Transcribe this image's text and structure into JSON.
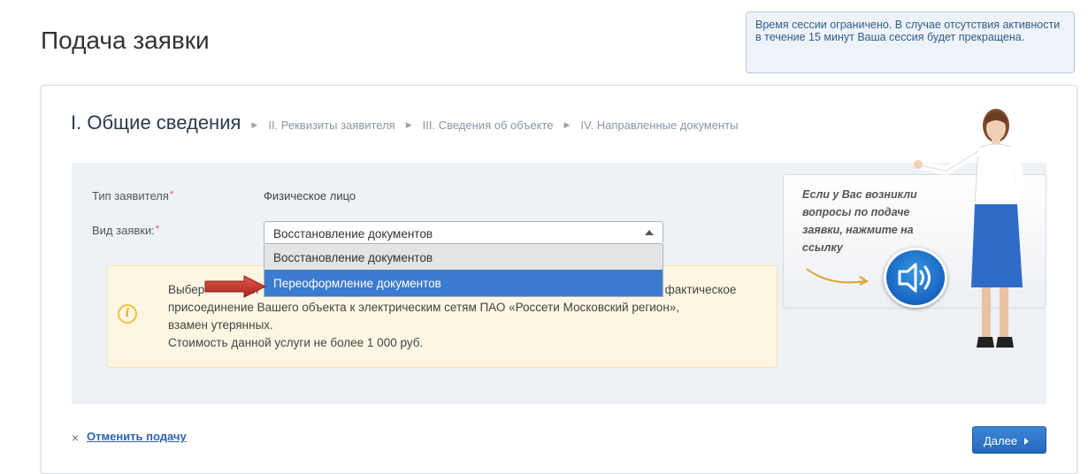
{
  "page": {
    "title": "Подача заявки"
  },
  "session": {
    "notice": "Время сессии ограничено. В случае отсутствия активности в течение 15 минут Ваша сессия будет прекращена."
  },
  "steps": [
    {
      "label": "I. Общие сведения",
      "active": true
    },
    {
      "label": "II. Реквизиты заявителя",
      "active": false
    },
    {
      "label": "III. Сведения об объекте",
      "active": false
    },
    {
      "label": "IV. Направленные документы",
      "active": false
    }
  ],
  "form": {
    "applicant_type_label": "Тип заявителя",
    "applicant_type_value": "Физическое лицо",
    "request_type_label": "Вид заявки:",
    "request_type_selected": "Восстановление документов",
    "options": [
      "Восстановление документов",
      "Переоформление документов"
    ],
    "highlighted_option": "Переоформление документов"
  },
  "info": {
    "icon": "info-icon",
    "line1_start": "Выбер",
    "line1_mid": "ни",
    "line1_end": "к фактическое",
    "line2": "присоединение Вашего объекта к электрическим сетям ПАО «Россети Московский регион»,",
    "line3": "взамен утерянных.",
    "line4": "Стоимость данной услуги не более 1 000 руб."
  },
  "help": {
    "text": "Если у Вас возникли вопросы по подаче заявки, нажмите на ссылку",
    "icon": "speaker-icon"
  },
  "actions": {
    "cancel_icon": "×",
    "cancel_label": "Отменить подачу",
    "next_label": "Далее"
  },
  "colors": {
    "accent": "#3b7bd0",
    "info_bg": "#fdf6e3",
    "panel_bg": "#eef1f5",
    "required": "#d9534f",
    "pointer_arrow": "#c0392b"
  }
}
